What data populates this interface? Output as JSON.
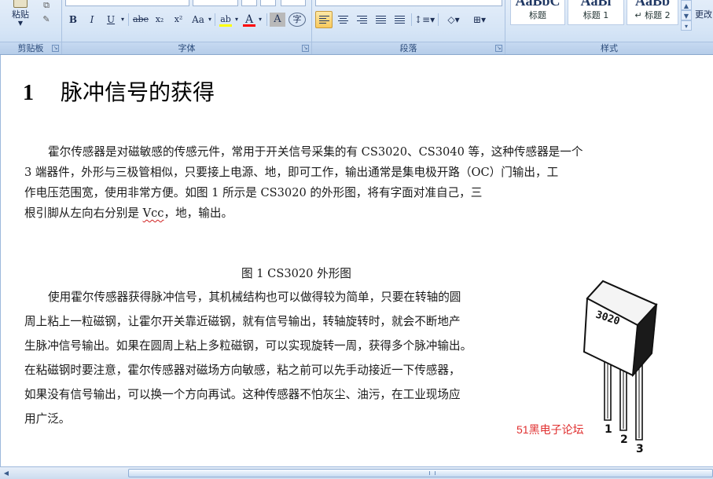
{
  "ribbon": {
    "clipboard": {
      "label": "剪贴板",
      "paste_label": "粘贴",
      "paste_arrow": "▼"
    },
    "font": {
      "label": "字体",
      "buttons": {
        "bold": "B",
        "italic": "I",
        "underline": "U",
        "strike": "abe",
        "subscript": "x₂",
        "superscript": "x²",
        "case": "Aa",
        "highlight": "ab",
        "color": "A",
        "shade": "A",
        "enclose": "字"
      },
      "highlight_color": "#ffff00",
      "font_color": "#ff0000"
    },
    "paragraph": {
      "label": "段落"
    },
    "styles": {
      "label": "样式",
      "tiles": [
        {
          "sample": "AaBbC",
          "name": "标题"
        },
        {
          "sample": "AaBl",
          "name": "标题 1"
        },
        {
          "sample": "AaBb",
          "name": "↵ 标题 2"
        }
      ],
      "change_label": "更改"
    }
  },
  "document": {
    "heading": {
      "number": "1",
      "text": "脉冲信号的获得"
    },
    "paragraph1": [
      "霍尔传感器是对磁敏感的传感元件，常用于开关信号采集的有 CS3020、CS3040 等，这种传感器是一个",
      "3 端器件，外形与三极管相似，只要接上电源、地，即可工作，输出通常是集电极开路（OC）门输出，工",
      "作电压范围宽，使用非常方便。如图 1 所示是 CS3020 的外形图，将有字面对准自己，三",
      "根引脚从左向右分别是 "
    ],
    "vcc": "Vcc",
    "p1_tail": "，地，输出。",
    "caption": "图 1   CS3020 外形图",
    "paragraph2": [
      "使用霍尔传感器获得脉冲信号，其机械结构也可以做得较为简单，只要在转轴的圆",
      "周上粘上一粒磁钢，让霍尔开关靠近磁钢，就有信号输出，转轴旋转时，就会不断地产",
      "生脉冲信号输出。如果在圆周上粘上多粒磁钢，可以实现旋转一周，获得多个脉冲输出。",
      "在粘磁钢时要注意，霍尔传感器对磁场方向敏感，粘之前可以先手动接近一下传感器，",
      "如果没有信号输出，可以换一个方向再试。这种传感器不怕灰尘、油污，在工业现场应",
      "用广泛。"
    ],
    "component": {
      "marking": "3020",
      "pins": [
        "1",
        "2",
        "3"
      ]
    },
    "watermark": "51黑电子论坛"
  }
}
